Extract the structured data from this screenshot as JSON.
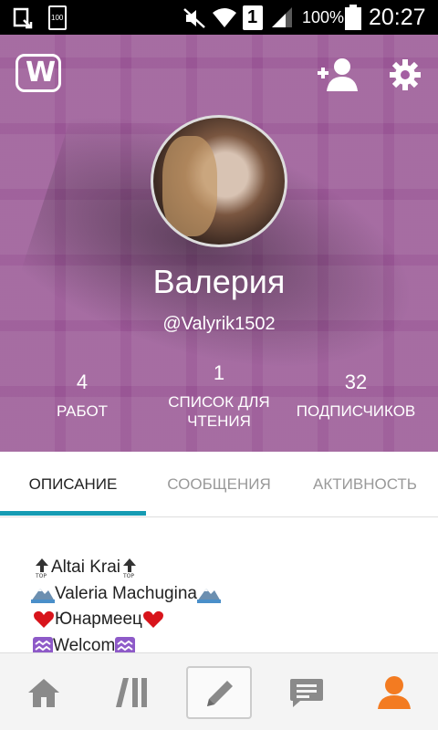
{
  "status_bar": {
    "battery_percent": "100%",
    "time": "20:27",
    "sim_badge": "1",
    "storage_badge": "100",
    "icons": [
      "screenshot-icon",
      "storage-icon",
      "mute-icon",
      "wifi-icon",
      "sim-icon",
      "signal-icon",
      "battery-icon"
    ]
  },
  "header": {
    "logo_letter": "W",
    "profile": {
      "name": "Валерия",
      "username": "@Valyrik1502"
    },
    "stats": [
      {
        "value": "4",
        "label": "РАБОТ"
      },
      {
        "value": "1",
        "label_lines": [
          "СПИСОК ДЛЯ",
          "ЧТЕНИЯ"
        ]
      },
      {
        "value": "32",
        "label": "ПОДПИСЧИКОВ"
      }
    ],
    "actions": [
      "add-friend-icon",
      "settings-icon"
    ]
  },
  "tabs": [
    {
      "label": "ОПИСАНИЕ",
      "active": true
    },
    {
      "label": "СООБЩЕНИЯ",
      "active": false
    },
    {
      "label": "АКТИВНОСТЬ",
      "active": false
    }
  ],
  "description": {
    "lines": [
      {
        "text": "Altai Krai",
        "emoji": "top-arrow"
      },
      {
        "text": "Valeria Machugina",
        "emoji": "mountain"
      },
      {
        "text": "Юнармеец",
        "emoji": "heart"
      },
      {
        "text": "Welcom",
        "emoji": "aquarius"
      }
    ]
  },
  "bottom_nav": {
    "items": [
      "home-icon",
      "library-icon",
      "write-icon",
      "messages-icon",
      "profile-icon"
    ],
    "active": "profile-icon"
  },
  "colors": {
    "accent": "#169bb3",
    "nav_active": "#f37b21",
    "nav_inactive": "#8a8a8a",
    "header_bg": "#a45ea2"
  }
}
